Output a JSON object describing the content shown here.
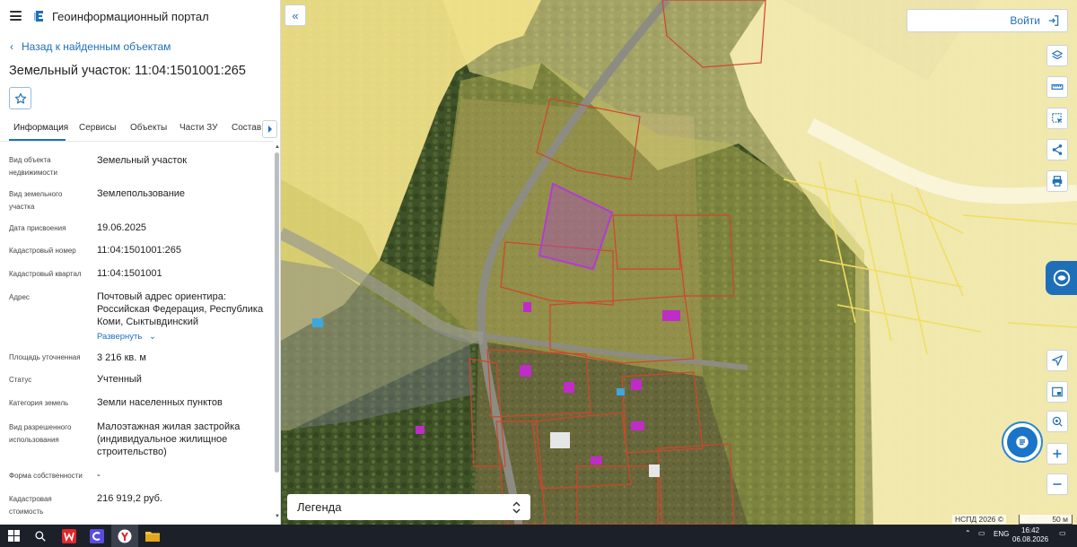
{
  "app": {
    "title": "Геоинформационный портал",
    "accent_color": "#1f6fb8"
  },
  "panel": {
    "back_label": "Назад к найденным объектам",
    "object_title": "Земельный участок: 11:04:1501001:265",
    "favorite_icon": "star-outline-icon",
    "tabs": [
      {
        "label": "Информация",
        "active": true
      },
      {
        "label": "Сервисы",
        "active": false
      },
      {
        "label": "Объекты",
        "active": false
      },
      {
        "label": "Части ЗУ",
        "active": false
      },
      {
        "label": "Состав",
        "active": false
      }
    ],
    "properties": [
      {
        "label": "Вид объекта недвижимости",
        "value": "Земельный участок"
      },
      {
        "label": "Вид земельного участка",
        "value": "Землепользование"
      },
      {
        "label": "Дата присвоения",
        "value": "19.06.2025"
      },
      {
        "label": "Кадастровый номер",
        "value": "11:04:1501001:265"
      },
      {
        "label": "Кадастровый квартал",
        "value": "11:04:1501001"
      },
      {
        "label": "Адрес",
        "value": "Почтовый адрес ориентира: Российская Федерация, Республика Коми, Сыктывдинский"
      },
      {
        "label": "Площадь уточненная",
        "value": "3 216 кв. м"
      },
      {
        "label": "Статус",
        "value": "Учтенный"
      },
      {
        "label": "Категория земель",
        "value": "Земли населенных пунктов"
      },
      {
        "label": "Вид разрешенного использования",
        "value": "Малоэтажная жилая застройка (индивидуальное жилищное строительство)"
      },
      {
        "label": "Форма собственности",
        "value": "-"
      },
      {
        "label": "Кадастровая стоимость",
        "value": "216 919,2 руб."
      }
    ],
    "expand_label": "Развернуть"
  },
  "map": {
    "login_label": "Войти",
    "legend_label": "Легенда",
    "copyright": "НСПД 2026 ©",
    "scale_label": "50 м",
    "tools": [
      "layers-icon",
      "ruler-icon",
      "select-area-icon",
      "share-icon",
      "print-icon"
    ],
    "nav_tools": [
      "geolocation-icon",
      "minimap-icon",
      "target-icon",
      "zoom-in-icon",
      "zoom-out-icon"
    ],
    "highlight_color": "#b23bd6",
    "parcel_color": "#d2452b",
    "zone_color": "#f3e48a"
  },
  "taskbar": {
    "lang": "ENG",
    "time": "16:42",
    "date": "06.08.2026"
  }
}
